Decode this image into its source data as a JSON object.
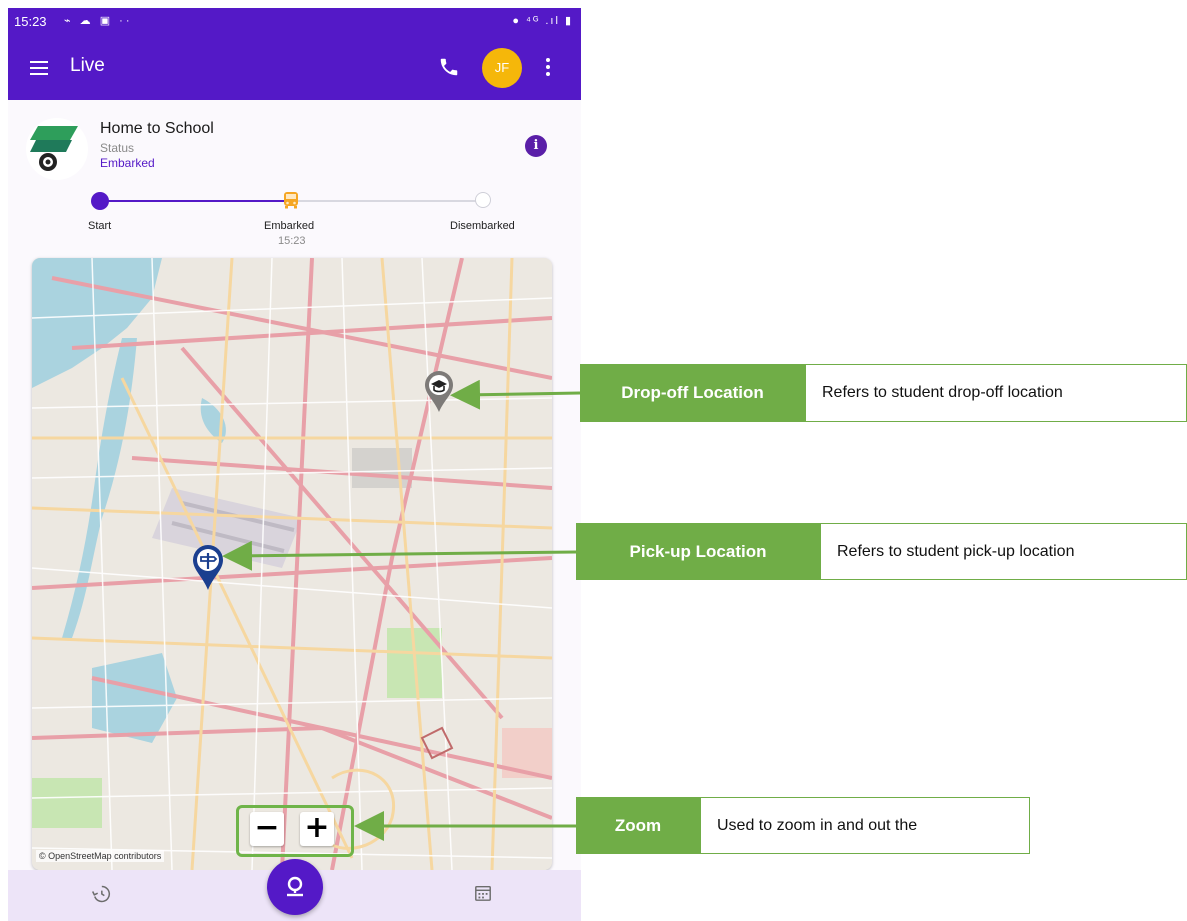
{
  "status_bar": {
    "time": "15:23",
    "left_icons": "⌁ ☁ ▣ ··",
    "right_icons": "● ⁴ᴳ .ıl ▮"
  },
  "app_bar": {
    "title": "Live",
    "avatar_initials": "JF",
    "menu_icon": "hamburger-menu-icon",
    "phone_icon": "phone-icon",
    "more_icon": "more-vert-icon"
  },
  "trip": {
    "title": "Home to School",
    "status_label": "Status",
    "status_value": "Embarked",
    "info_icon": "info-icon"
  },
  "progress": {
    "steps": [
      {
        "label": "Start",
        "time": "",
        "state": "done"
      },
      {
        "label": "Embarked",
        "time": "15:23",
        "state": "current"
      },
      {
        "label": "Disembarked",
        "time": "",
        "state": "pending"
      }
    ]
  },
  "map": {
    "attribution": "© OpenStreetMap contributors",
    "markers": [
      {
        "name": "drop-off-pin",
        "icon": "graduation-cap-icon"
      },
      {
        "name": "pick-up-pin",
        "icon": "pickup-icon"
      }
    ],
    "zoom_out": "−",
    "zoom_in": "+"
  },
  "bottom_nav": {
    "left_icon": "history-icon",
    "center_icon": "location-pin-icon",
    "right_icon": "calendar-icon"
  },
  "callouts": [
    {
      "label": "Drop-off Location",
      "description": "Refers to student drop-off location"
    },
    {
      "label": "Pick-up Location",
      "description": "Refers to student pick-up location"
    },
    {
      "label": "Zoom",
      "description": "Used to zoom in and out the"
    }
  ],
  "colors": {
    "app_primary": "#5419c7",
    "avatar": "#f5b70a",
    "callout_green": "#70ad47",
    "map_bg": "#ece8e1",
    "bottom_nav": "#ede4f8"
  }
}
